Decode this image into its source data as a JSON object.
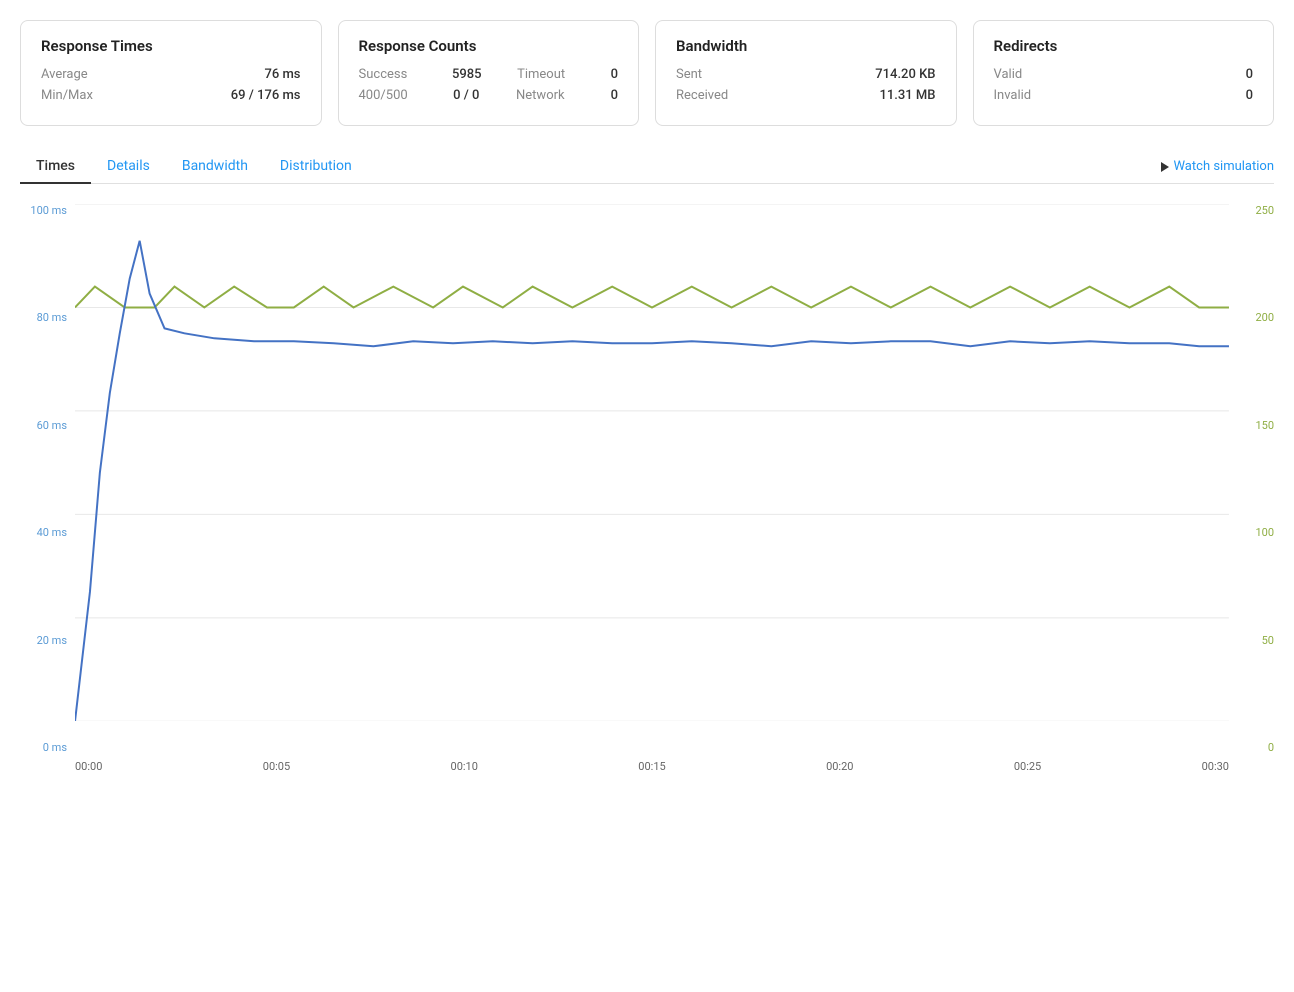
{
  "stats": {
    "response_times": {
      "title": "Response Times",
      "rows": [
        {
          "label": "Average",
          "value": "76 ms"
        },
        {
          "label": "Min/Max",
          "value": "69 / 176 ms"
        }
      ]
    },
    "response_counts": {
      "title": "Response Counts",
      "rows": [
        {
          "label": "Success",
          "value": "5985",
          "label2": "Timeout",
          "value2": "0"
        },
        {
          "label": "400/500",
          "value": "0 / 0",
          "label2": "Network",
          "value2": "0"
        }
      ]
    },
    "bandwidth": {
      "title": "Bandwidth",
      "rows": [
        {
          "label": "Sent",
          "value": "714.20 KB"
        },
        {
          "label": "Received",
          "value": "11.31 MB"
        }
      ]
    },
    "redirects": {
      "title": "Redirects",
      "rows": [
        {
          "label": "Valid",
          "value": "0"
        },
        {
          "label": "Invalid",
          "value": "0"
        }
      ]
    }
  },
  "tabs": [
    {
      "id": "times",
      "label": "Times",
      "active": true
    },
    {
      "id": "details",
      "label": "Details",
      "active": false
    },
    {
      "id": "bandwidth",
      "label": "Bandwidth",
      "active": false
    },
    {
      "id": "distribution",
      "label": "Distribution",
      "active": false
    }
  ],
  "watch_simulation": "Watch simulation",
  "chart": {
    "y_left_labels": [
      "0 ms",
      "20 ms",
      "40 ms",
      "60 ms",
      "80 ms",
      "100 ms"
    ],
    "y_right_labels": [
      "0",
      "50",
      "100",
      "150",
      "200",
      "250"
    ],
    "x_labels": [
      "00:00",
      "00:05",
      "00:10",
      "00:15",
      "00:20",
      "00:25",
      "00:30"
    ]
  }
}
